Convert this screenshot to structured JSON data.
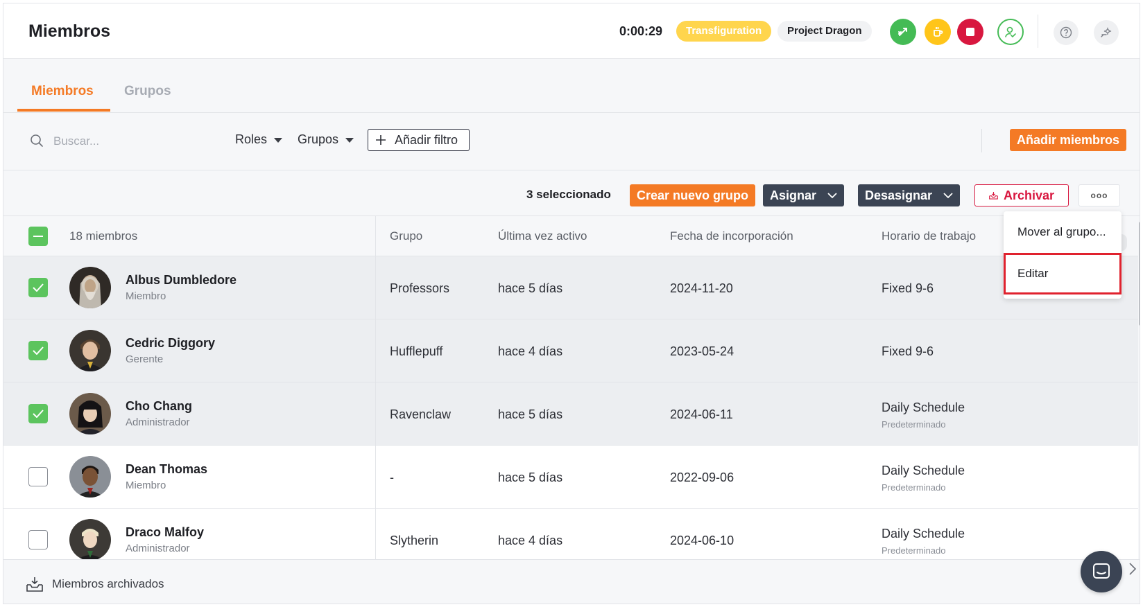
{
  "header": {
    "title": "Miembros",
    "timer": "0:00:29",
    "task": "Transfiguration",
    "project": "Project Dragon"
  },
  "tabs": [
    {
      "label": "Miembros",
      "active": true
    },
    {
      "label": "Grupos",
      "active": false
    }
  ],
  "filters": {
    "search_placeholder": "Buscar...",
    "roles": "Roles",
    "groups": "Grupos",
    "add_filter": "Añadir filtro",
    "add_members": "Añadir miembros"
  },
  "actions": {
    "selected": "3 seleccionado",
    "new_group": "Crear nuevo grupo",
    "assign": "Asignar",
    "unassign": "Desasignar",
    "archive": "Archivar",
    "more": "ooo"
  },
  "menu": {
    "move": "Mover al grupo...",
    "edit": "Editar"
  },
  "table": {
    "count": "18 miembros",
    "columns": {
      "group": "Grupo",
      "last_active": "Última vez activo",
      "joined": "Fecha de incorporación",
      "schedule": "Horario de trabajo"
    },
    "rows": [
      {
        "name": "Albus Dumbledore",
        "role": "Miembro",
        "group": "Professors",
        "last": "hace 5 días",
        "joined": "2024-11-20",
        "schedule": "Fixed 9-6",
        "schedule_sub": "",
        "selected": true
      },
      {
        "name": "Cedric Diggory",
        "role": "Gerente",
        "group": "Hufflepuff",
        "last": "hace 4 días",
        "joined": "2023-05-24",
        "schedule": "Fixed 9-6",
        "schedule_sub": "",
        "selected": true
      },
      {
        "name": "Cho Chang",
        "role": "Administrador",
        "group": "Ravenclaw",
        "last": "hace 5 días",
        "joined": "2024-06-11",
        "schedule": "Daily Schedule",
        "schedule_sub": "Predeterminado",
        "selected": true
      },
      {
        "name": "Dean Thomas",
        "role": "Miembro",
        "group": "-",
        "last": "hace 5 días",
        "joined": "2022-09-06",
        "schedule": "Daily Schedule",
        "schedule_sub": "Predeterminado",
        "selected": false
      },
      {
        "name": "Draco Malfoy",
        "role": "Administrador",
        "group": "Slytherin",
        "last": "hace 4 días",
        "joined": "2024-06-10",
        "schedule": "Daily Schedule",
        "schedule_sub": "Predeterminado",
        "selected": false
      }
    ]
  },
  "footer": {
    "archived": "Miembros archivados"
  },
  "colors": {
    "accent": "#f47a25",
    "green": "#44bb55",
    "yellow": "#ffc51a",
    "red": "#d8173f",
    "dark": "#3b4454"
  }
}
